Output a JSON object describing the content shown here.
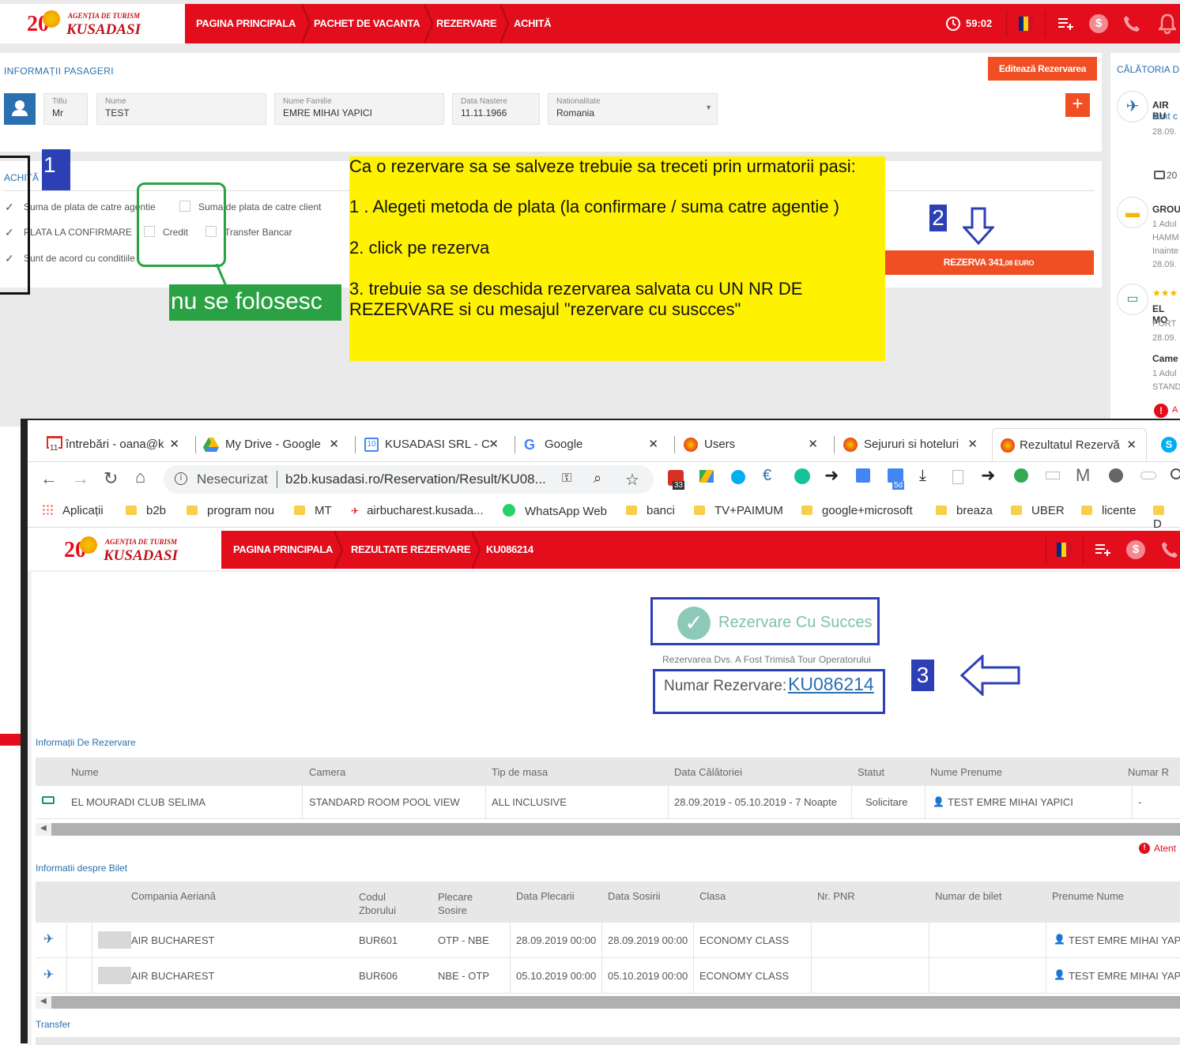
{
  "top": {
    "logo": {
      "number": "20",
      "line1": "AGENȚIA DE TURISM",
      "line2": "KUSADASI"
    },
    "nav": [
      "PAGINA PRINCIPALA",
      "PACHET DE VACANTA",
      "REZERVARE",
      "ACHITĂ"
    ],
    "timer": "59:02"
  },
  "passenger": {
    "section_title": "INFORMAȚII PASAGERI",
    "edit_button": "Editează Rezervarea",
    "fields": [
      {
        "label": "Titlu",
        "value": "Mr"
      },
      {
        "label": "Nume",
        "value": "TEST"
      },
      {
        "label": "Nume Familie",
        "value": "EMRE MIHAI YAPICI"
      },
      {
        "label": "Data Nastere",
        "value": "11.11.1966"
      },
      {
        "label": "Nationalitate",
        "value": "Romania"
      }
    ],
    "add": "+"
  },
  "right_panel": {
    "title": "CĂLĂTORIA D",
    "flight_line1": "AIR BU",
    "flight_line2": "sunt c",
    "flight_date": "28.09.",
    "bag_count": "20",
    "transfer_title": "GROU",
    "transfer_l1": "1 Adul",
    "transfer_l2": "HAMM",
    "transfer_l3": "Inainte",
    "transfer_date": "28.09.",
    "stars": "★★★",
    "hotel_title": "EL MO",
    "hotel_l1": "PORT",
    "hotel_date": "28.09.",
    "room_title": "Came",
    "room_l1": "1 Adul",
    "room_l2": "STAND",
    "alert": "A"
  },
  "payment": {
    "section_title": "ACHITĂ",
    "options": [
      {
        "label": "Suma de plata de catre agentie",
        "checked": true
      },
      {
        "label": "Suma de plata de catre client",
        "checked": false
      },
      {
        "label": "PLATA LA CONFIRMARE",
        "checked": true
      },
      {
        "label": "Credit",
        "checked": false
      },
      {
        "label": "Transfer Bancar",
        "checked": false
      },
      {
        "label": "Sunt de acord cu conditiile",
        "checked": true
      }
    ],
    "book_button": "REZERVA 341",
    "book_button_decimals": ",08 EURO"
  },
  "annotations": {
    "n1": "1",
    "n2": "2",
    "n3": "3",
    "not_used": "nu se folosesc",
    "instructions": [
      "Ca o rezervare sa se salveze trebuie sa treceti prin urmatorii pasi:",
      "1 . Alegeti metoda de plata (la confirmare / suma catre agentie )",
      "2. click pe rezerva",
      "3. trebuie sa se deschida rezervarea salvata cu UN NR DE REZERVARE  si cu mesajul \"rezervare cu suscces\""
    ]
  },
  "browser": {
    "tabs": [
      {
        "title": "întrebări - oana@k",
        "icon": "gmail-icon"
      },
      {
        "title": "My Drive - Google",
        "icon": "drive-icon"
      },
      {
        "title": "KUSADASI SRL - C",
        "icon": "calendar-icon"
      },
      {
        "title": "Google",
        "icon": "google-icon"
      },
      {
        "title": "Users",
        "icon": "kusadasi-icon"
      },
      {
        "title": "Sejururi si hoteluri",
        "icon": "kusadasi-icon"
      },
      {
        "title": "Rezultatul Rezervă",
        "icon": "kusadasi-icon"
      }
    ],
    "gmail_badge": "11",
    "calendar_badge": "10",
    "security": "Nesecurizat",
    "url": "b2b.kusadasi.ro/Reservation/Result/KU08...",
    "ext_badge_33": "33",
    "ext_badge_5d": "5d",
    "bookmarks": [
      "Aplicații",
      "b2b",
      "program nou",
      "MT",
      "airbucharest.kusada...",
      "WhatsApp Web",
      "banci",
      "TV+PAIMUM",
      "google+microsoft",
      "breaza",
      "UBER",
      "licente",
      "D"
    ]
  },
  "result": {
    "nav": [
      "PAGINA PRINCIPALA",
      "REZULTATE REZERVARE",
      "KU086214"
    ],
    "success": "Rezervare Cu Succes",
    "sent_note": "Rezervarea Dvs. A Fost Trimisă Tour Operatorului",
    "number_label": "Numar Rezervare:",
    "number": "KU086214",
    "reservation_section": "Informații De Rezervare",
    "res_headers": [
      "Nume",
      "Camera",
      "Tip de masa",
      "Data Călătoriei",
      "Statut",
      "Nume Prenume",
      "Numar R"
    ],
    "res_row": [
      "EL MOURADI CLUB SELIMA",
      "STANDARD ROOM POOL VIEW",
      "ALL INCLUSIVE",
      "28.09.2019 - 05.10.2019 - 7 Noapte",
      "Solicitare",
      "TEST EMRE MIHAI YAPICI",
      "-"
    ],
    "attention": "Atent",
    "ticket_section": "Informatii despre Bilet",
    "ticket_headers": [
      "Compania Aeriană",
      "Codul Zborului",
      "Plecare Sosire",
      "Data Plecarii",
      "Data Sosirii",
      "Clasa",
      "Nr. PNR",
      "Numar de bilet",
      "Prenume Nume"
    ],
    "ticket_rows": [
      [
        "AIR BUCHAREST",
        "BUR601",
        "OTP - NBE",
        "28.09.2019 00:00",
        "28.09.2019 00:00",
        "ECONOMY CLASS",
        "",
        "",
        "TEST EMRE MIHAI YAPI"
      ],
      [
        "AIR BUCHAREST",
        "BUR606",
        "NBE - OTP",
        "05.10.2019 00:00",
        "05.10.2019 00:00",
        "ECONOMY CLASS",
        "",
        "",
        "TEST EMRE MIHAI YAPI"
      ]
    ],
    "transfer_section": "Transfer"
  },
  "colors": {
    "brand_red": "#e30d1c",
    "annot_blue": "#2d3fb5",
    "annot_green": "#2aa243",
    "note_yellow": "#fff200",
    "link_blue": "#2a6fb0"
  }
}
